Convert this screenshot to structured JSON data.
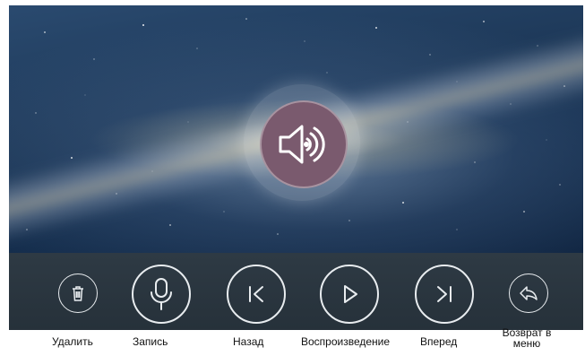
{
  "playback": {
    "status_icon": "speaker-sound-icon"
  },
  "toolbar": {
    "buttons": [
      {
        "icon": "trash-icon",
        "label": "Удалить"
      },
      {
        "icon": "microphone-icon",
        "label": "Запись"
      },
      {
        "icon": "previous-icon",
        "label": "Назад"
      },
      {
        "icon": "play-icon",
        "label": "Воспроизведение"
      },
      {
        "icon": "next-icon",
        "label": "Вперед"
      },
      {
        "icon": "return-icon",
        "label_line1": "Возврат в",
        "label_line2": "меню"
      }
    ]
  },
  "colors": {
    "toolbar_bg": "#2a353f",
    "speaker_fill": "#7a5a6e",
    "icon_stroke": "#e8ecef"
  }
}
